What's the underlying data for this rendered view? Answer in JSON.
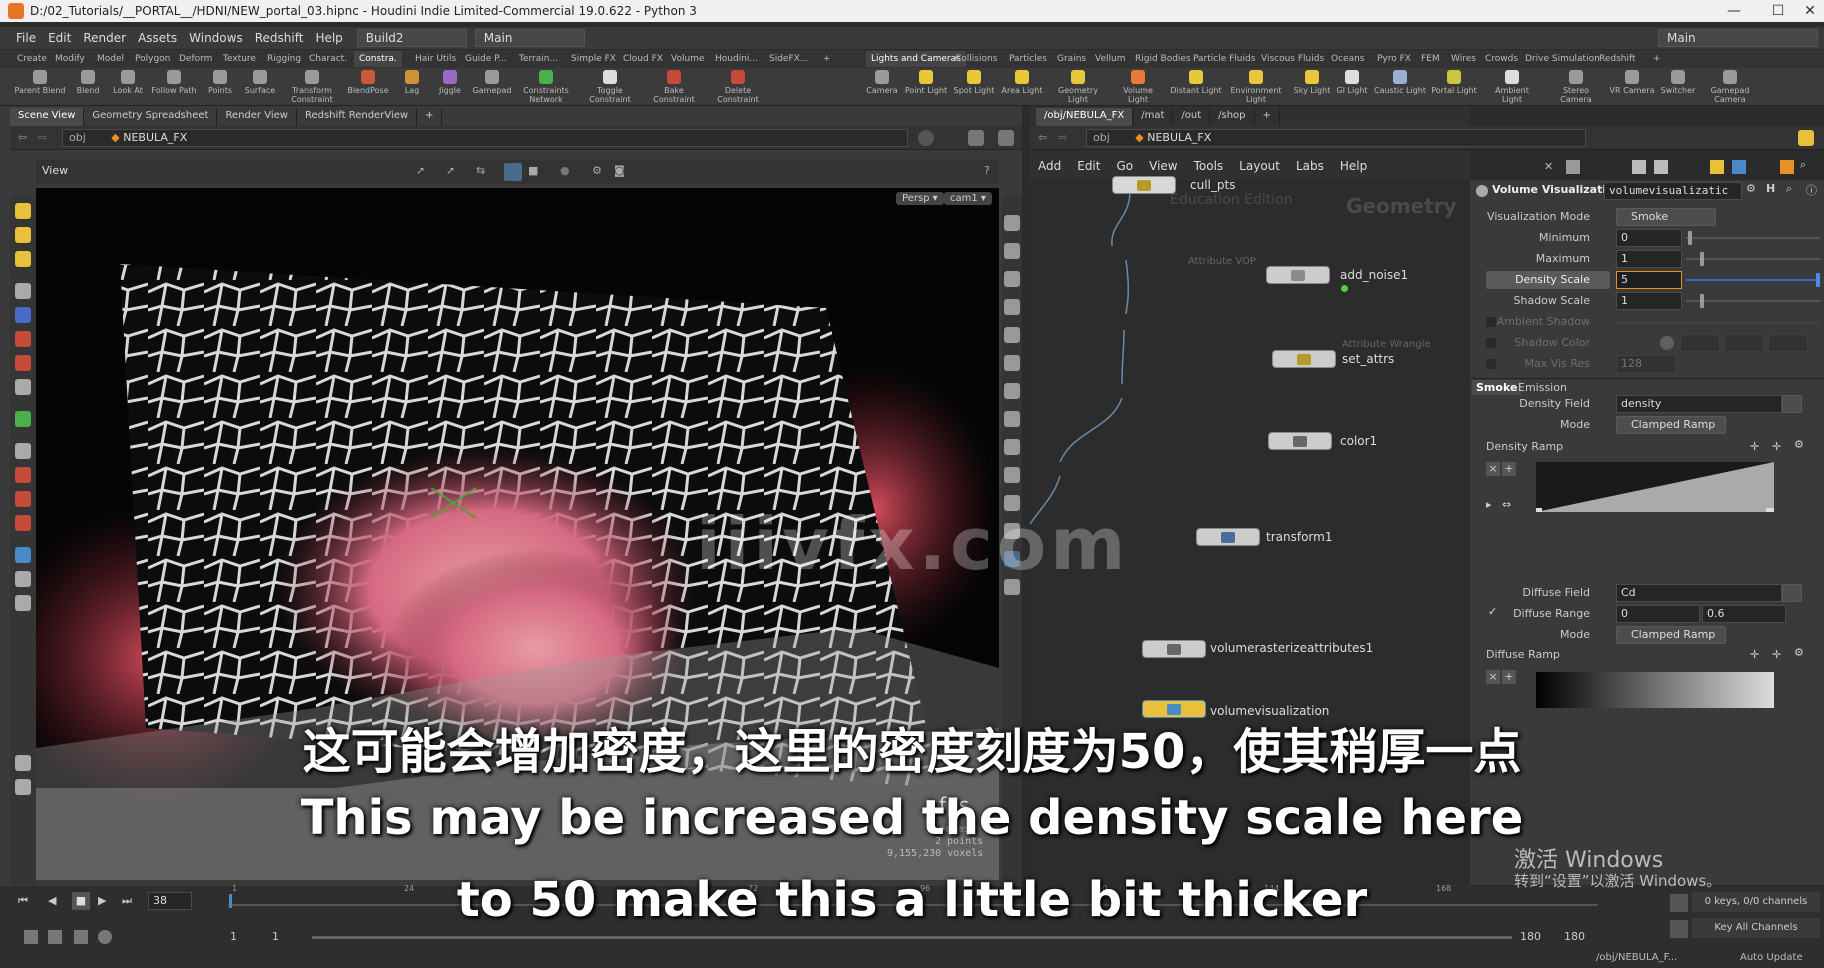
{
  "title": "D:/02_Tutorials/__PORTAL__/HDNI/NEW_portal_03.hipnc - Houdini Indie Limited-Commercial 19.0.622 - Python 3",
  "menu": [
    "File",
    "Edit",
    "Render",
    "Assets",
    "Windows",
    "Redshift",
    "Help"
  ],
  "desktop": "Build2",
  "desktop_main": "Main",
  "right_desktop": "Main",
  "shelf_tabs_left": [
    "Create",
    "Modify",
    "Model",
    "Polygon",
    "Deform",
    "Texture",
    "Rigging",
    "Charact.",
    "Constra.",
    "Hair Utils",
    "Guide P...",
    "Terrain...",
    "Simple FX",
    "Cloud FX",
    "Volume",
    "Houdini...",
    "SideFX..."
  ],
  "shelf_tabs_right": [
    "Lights and Cameras",
    "Collisions",
    "Particles",
    "Grains",
    "Vellum",
    "Rigid Bodies",
    "Particle Fluids",
    "Viscous Fluids",
    "Oceans",
    "Pyro FX",
    "FEM",
    "Wires",
    "Crowds",
    "Drive Simulation",
    "Redshift"
  ],
  "tools_left": [
    "Parent Blend",
    "Blend",
    "Look At",
    "Follow Path",
    "Points",
    "Surface",
    "Transform Constraint",
    "BlendPose",
    "Lag",
    "Jiggle",
    "Gamepad",
    "Constraints Network",
    "Toggle Constraint",
    "Bake Constraint",
    "Delete Constraint"
  ],
  "tools_right": [
    "Camera",
    "Point Light",
    "Spot Light",
    "Area Light",
    "Geometry Light",
    "Volume Light",
    "Distant Light",
    "Environment Light",
    "Sky Light",
    "GI Light",
    "Caustic Light",
    "Portal Light",
    "Ambient Light",
    "Stereo Camera",
    "VR Camera",
    "Switcher",
    "Gamepad Camera"
  ],
  "left_tabs": [
    "Scene View",
    "Geometry Spreadsheet",
    "Render View",
    "Redshift RenderView"
  ],
  "left_path": {
    "root": "obj",
    "node": "NEBULA_FX"
  },
  "view_label": "View",
  "persp": "Persp ▾",
  "cam": "cam1 ▾",
  "fps": "fps",
  "prims": "prims",
  "points": "2 points",
  "voxels": "9,155,230 voxels",
  "right_tabs": [
    "/obj/NEBULA_FX",
    "/mat",
    "/out",
    "/shop"
  ],
  "right_path": {
    "root": "obj",
    "node": "NEBULA_FX"
  },
  "net_menu": [
    "Add",
    "Edit",
    "Go",
    "View",
    "Tools",
    "Layout",
    "Labs",
    "Help"
  ],
  "net_bg_labels": {
    "edu": "Education Edition",
    "geo": "Geometry"
  },
  "nodes": [
    {
      "name": "cull_pts",
      "sub": ""
    },
    {
      "name": "add_noise1",
      "sub": "Attribute VOP"
    },
    {
      "name": "set_attrs",
      "sub": "Attribute Wrangle"
    },
    {
      "name": "color1",
      "sub": ""
    },
    {
      "name": "transform1",
      "sub": ""
    },
    {
      "name": "volumerasterizeattributes1",
      "sub": ""
    },
    {
      "name": "volumevisualization",
      "sub": ""
    }
  ],
  "parm": {
    "type": "Volume Visualization",
    "name": "volumevisualizatic",
    "vis_mode_label": "Visualization Mode",
    "vis_mode": "Smoke",
    "min_label": "Minimum",
    "min": "0",
    "max_label": "Maximum",
    "max": "1",
    "density_scale_label": "Density Scale",
    "density_scale": "5",
    "shadow_scale_label": "Shadow Scale",
    "shadow_scale": "1",
    "ambient_label": "Ambient Shadow",
    "shadow_color_label": "Shadow Color",
    "maxres_label": "Max Vis Res",
    "maxres": "128",
    "tab_smoke": "Smoke",
    "tab_emission": "Emission",
    "density_field_label": "Density Field",
    "density_field": "density",
    "mode_label": "Mode",
    "mode": "Clamped Ramp",
    "density_ramp_label": "Density Ramp",
    "diffuse_field_label": "Diffuse Field",
    "diffuse_field": "Cd",
    "diffuse_range_label": "Diffuse Range",
    "diffuse_range_a": "0",
    "diffuse_range_b": "0.6",
    "mode2_label": "Mode",
    "mode2": "Clamped Ramp",
    "diffuse_ramp_label": "Diffuse Ramp"
  },
  "timeline": {
    "frame": "38",
    "start": "1",
    "start2": "1",
    "end": "180",
    "end2": "180",
    "keys": "0 keys, 0/0 channels",
    "key_all": "Key All Channels",
    "auto": "Auto Update",
    "status_path": "/obj/NEBULA_F...",
    "ticks": [
      "1",
      "24",
      "48",
      "72",
      "96",
      "120",
      "144",
      "168"
    ]
  },
  "watermark": "iiivfx.com",
  "subtitle_cn": "这可能会增加密度，这里的密度刻度为50，使其稍厚一点",
  "subtitle_en1": "This may be increased the density scale here",
  "subtitle_en2": "to 50 make this a little bit thicker",
  "activate1": "激活 Windows",
  "activate2": "转到“设置”以激活 Windows。"
}
